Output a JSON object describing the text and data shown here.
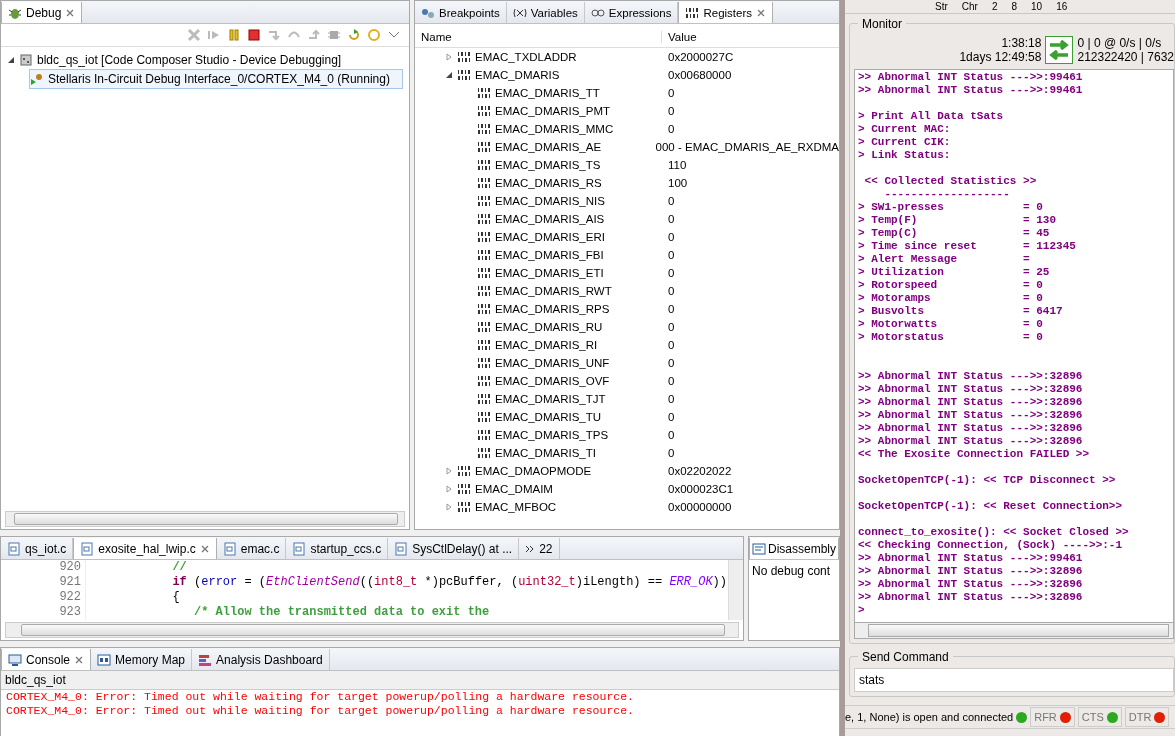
{
  "debug": {
    "tab": {
      "label": "Debug",
      "selected": true
    },
    "tree": [
      {
        "label": "bldc_qs_iot [Code Composer Studio - Device Debugging]",
        "expanded": true,
        "children": [
          {
            "label": "Stellaris In-Circuit Debug Interface_0/CORTEX_M4_0 (Running)",
            "selected": true
          }
        ]
      }
    ]
  },
  "registers": {
    "tabs": [
      {
        "label": "Breakpoints",
        "selected": false
      },
      {
        "label": "Variables",
        "selected": false
      },
      {
        "label": "Expressions",
        "selected": false
      },
      {
        "label": "Registers",
        "selected": true
      }
    ],
    "columns": [
      "Name",
      "Value"
    ],
    "rows": [
      {
        "name": "EMAC_TXDLADDR",
        "value": "0x2000027C",
        "expanded": false
      },
      {
        "name": "EMAC_DMARIS",
        "value": "0x00680000",
        "expanded": true,
        "children": [
          {
            "name": "EMAC_DMARIS_TT",
            "value": "0"
          },
          {
            "name": "EMAC_DMARIS_PMT",
            "value": "0"
          },
          {
            "name": "EMAC_DMARIS_MMC",
            "value": "0"
          },
          {
            "name": "EMAC_DMARIS_AE",
            "value": "000 - EMAC_DMARIS_AE_RXDMA"
          },
          {
            "name": "EMAC_DMARIS_TS",
            "value": "110"
          },
          {
            "name": "EMAC_DMARIS_RS",
            "value": "100"
          },
          {
            "name": "EMAC_DMARIS_NIS",
            "value": "0"
          },
          {
            "name": "EMAC_DMARIS_AIS",
            "value": "0"
          },
          {
            "name": "EMAC_DMARIS_ERI",
            "value": "0"
          },
          {
            "name": "EMAC_DMARIS_FBI",
            "value": "0"
          },
          {
            "name": "EMAC_DMARIS_ETI",
            "value": "0"
          },
          {
            "name": "EMAC_DMARIS_RWT",
            "value": "0"
          },
          {
            "name": "EMAC_DMARIS_RPS",
            "value": "0"
          },
          {
            "name": "EMAC_DMARIS_RU",
            "value": "0"
          },
          {
            "name": "EMAC_DMARIS_RI",
            "value": "0"
          },
          {
            "name": "EMAC_DMARIS_UNF",
            "value": "0"
          },
          {
            "name": "EMAC_DMARIS_OVF",
            "value": "0"
          },
          {
            "name": "EMAC_DMARIS_TJT",
            "value": "0"
          },
          {
            "name": "EMAC_DMARIS_TU",
            "value": "0"
          },
          {
            "name": "EMAC_DMARIS_TPS",
            "value": "0"
          },
          {
            "name": "EMAC_DMARIS_TI",
            "value": "0"
          }
        ]
      },
      {
        "name": "EMAC_DMAOPMODE",
        "value": "0x02202022",
        "expanded": false
      },
      {
        "name": "EMAC_DMAIM",
        "value": "0x000023C1",
        "expanded": false
      },
      {
        "name": "EMAC_MFBOC",
        "value": "0x00000000",
        "expanded": false
      }
    ]
  },
  "editor": {
    "tabs": [
      {
        "label": "qs_iot.c",
        "selected": false
      },
      {
        "label": "exosite_hal_lwip.c",
        "selected": true
      },
      {
        "label": "emac.c",
        "selected": false
      },
      {
        "label": "startup_ccs.c",
        "selected": false
      },
      {
        "label": "SysCtlDelay() at ...",
        "selected": false
      }
    ],
    "overflow": "22",
    "lines": [
      {
        "number": "920",
        "tokens": [
          {
            "text": "            //",
            "kind": "comment"
          }
        ]
      },
      {
        "number": "921",
        "tokens": [
          {
            "text": "            if",
            "kind": "keyword"
          },
          {
            "text": " (",
            "kind": "plain"
          },
          {
            "text": "error",
            "kind": "variable"
          },
          {
            "text": " = (",
            "kind": "plain"
          },
          {
            "text": "EthClientSend",
            "kind": "function"
          },
          {
            "text": "((",
            "kind": "plain"
          },
          {
            "text": "int8_t",
            "kind": "type"
          },
          {
            "text": " *)pcBuffer, (",
            "kind": "plain"
          },
          {
            "text": "uint32_t",
            "kind": "type"
          },
          {
            "text": ")iLength) == ",
            "kind": "plain"
          },
          {
            "text": "ERR_OK",
            "kind": "constant"
          },
          {
            "text": "))",
            "kind": "plain"
          }
        ]
      },
      {
        "number": "922",
        "tokens": [
          {
            "text": "            {",
            "kind": "plain"
          }
        ]
      },
      {
        "number": "923",
        "tokens": [
          {
            "text": "               /* Allow the transmitted data to exit the",
            "kind": "comment"
          }
        ]
      }
    ]
  },
  "disassembly": {
    "tab": "Disassembly",
    "message": "No debug cont"
  },
  "console": {
    "tabs": [
      {
        "label": "Console",
        "selected": true
      },
      {
        "label": "Memory Map",
        "selected": false
      },
      {
        "label": "Analysis Dashboard",
        "selected": false
      }
    ],
    "title": "bldc_qs_iot",
    "lines": [
      "CORTEX_M4_0: Error: Timed out while waiting for target powerup/polling a hardware resource.",
      "CORTEX_M4_0: Error: Timed out while waiting for target powerup/polling a hardware resource."
    ]
  },
  "terminal": {
    "toolbar": [
      "Str",
      "Chr",
      "2",
      "8",
      "10",
      "16"
    ],
    "monitor": {
      "title": "Monitor",
      "clock": "1:38:18",
      "uptime": "1days 12:49:58",
      "rate": "0 | 0 @ 0/s | 0/s",
      "bytes": "212322420 | 7632"
    },
    "blocks": [
      {
        "lines": [
          ">> Abnormal INT Status --->>:99461",
          ">> Abnormal INT Status --->>:99461"
        ]
      },
      {
        "lines": [
          "> Print All Data tSats",
          "> Current MAC:",
          "> Current CIK:",
          "> Link Status:"
        ]
      },
      {
        "lines": [
          " << Collected Statistics >>",
          "    -------------------",
          "> SW1-presses            = 0",
          "> Temp(F)                = 130",
          "> Temp(C)                = 45",
          "> Time since reset       = 112345",
          "> Alert Message          =",
          "> Utilization            = 25",
          "> Rotorspeed             = 0",
          "> Motoramps              = 0",
          "> Busvolts               = 6417",
          "> Motorwatts             = 0",
          "> Motorstatus            = 0"
        ]
      },
      {
        "extra_space": true,
        "lines": [
          ">> Abnormal INT Status --->>:32896",
          ">> Abnormal INT Status --->>:32896",
          ">> Abnormal INT Status --->>:32896",
          ">> Abnormal INT Status --->>:32896",
          ">> Abnormal INT Status --->>:32896",
          ">> Abnormal INT Status --->>:32896",
          "<< The Exosite Connection FAILED >>"
        ]
      },
      {
        "lines": [
          "SocketOpenTCP(-1): << TCP Disconnect >>"
        ]
      },
      {
        "lines": [
          "SocketOpenTCP(-1): << Reset Connection>>"
        ]
      },
      {
        "lines": [
          "connect_to_exosite(): << Socket Closed >>",
          "<< Checking Connection, (Sock) ---->>:-1",
          ">> Abnormal INT Status --->>:99461",
          ">> Abnormal INT Status --->>:32896",
          ">> Abnormal INT Status --->>:32896",
          ">> Abnormal INT Status --->>:32896",
          ">"
        ]
      }
    ],
    "send": {
      "title": "Send Command",
      "value": "stats"
    },
    "status": {
      "text": "e, 1, None) is open and connected",
      "color": "#2ea820"
    },
    "indicators": [
      {
        "label": "RFR",
        "color": "#e02000"
      },
      {
        "label": "CTS",
        "color": "#2ea820"
      },
      {
        "label": "DTR",
        "color": "#e02000"
      }
    ]
  }
}
